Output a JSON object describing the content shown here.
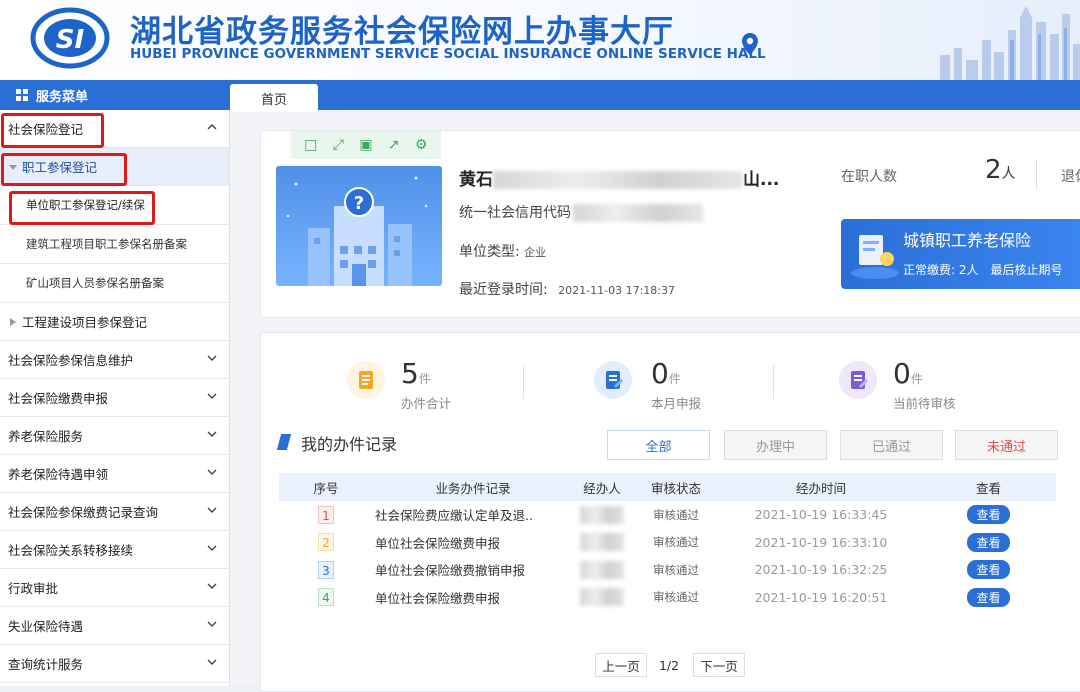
{
  "header": {
    "title_zh": "湖北省政务服务社会保险网上办事大厅",
    "title_en": "HUBEI PROVINCE GOVERNMENT SERVICE SOCIAL INSURANCE ONLINE SERVICE HALL",
    "logo_text": "SI"
  },
  "tabs": {
    "home": "首页"
  },
  "sidebar": {
    "header": "服务菜单",
    "items": [
      {
        "label": "社会保险登记",
        "icon": "chevron-up-icon"
      },
      {
        "label": "职工参保登记",
        "icon": "caret-down-icon"
      },
      {
        "label": "单位职工参保登记/续保"
      },
      {
        "label": "建筑工程项目职工参保名册备案"
      },
      {
        "label": "矿山项目人员参保名册备案"
      },
      {
        "label": "工程建设项目参保登记",
        "icon": "caret-right-icon"
      },
      {
        "label": "社会保险参保信息维护",
        "icon": "chevron-down-icon"
      },
      {
        "label": "社会保险缴费申报",
        "icon": "chevron-down-icon"
      },
      {
        "label": "养老保险服务",
        "icon": "chevron-down-icon"
      },
      {
        "label": "养老保险待遇申领",
        "icon": "chevron-down-icon"
      },
      {
        "label": "社会保险参保缴费记录查询",
        "icon": "chevron-down-icon"
      },
      {
        "label": "社会保险关系转移接续",
        "icon": "chevron-down-icon"
      },
      {
        "label": "行政审批",
        "icon": "chevron-down-icon"
      },
      {
        "label": "失业保险待遇",
        "icon": "chevron-down-icon"
      },
      {
        "label": "查询统计服务",
        "icon": "chevron-down-icon"
      }
    ]
  },
  "profile": {
    "company_name_start": "黄石",
    "company_name_end": "山...",
    "credit_code_label": "统一社会信用代码",
    "unit_type_label": "单位类型:",
    "unit_type_value": "企业",
    "last_login_label": "最近登录时间:",
    "last_login_value": "2021-11-03 17:18:37",
    "employees_label": "在职人数",
    "employees_value": "2",
    "employees_unit": "人",
    "retired_label": "退休"
  },
  "pension_card": {
    "title": "城镇职工养老保险",
    "normal_label": "正常缴费:",
    "normal_value": "2人",
    "last_check_label": "最后核止期号"
  },
  "stats": [
    {
      "value": "5",
      "unit": "件",
      "label": "办件合计",
      "color": "#f5a623"
    },
    {
      "value": "0",
      "unit": "件",
      "label": "本月申报",
      "color": "#2a6fd6"
    },
    {
      "value": "0",
      "unit": "件",
      "label": "当前待审核",
      "color": "#7b5bd6"
    }
  ],
  "records": {
    "title": "我的办件记录",
    "filters": [
      "全部",
      "办理中",
      "已通过",
      "未通过"
    ],
    "columns": [
      "序号",
      "业务办件记录",
      "经办人",
      "审核状态",
      "经办时间",
      "查看"
    ],
    "rows": [
      {
        "no": "1",
        "name": "社会保险费应缴认定单及退..",
        "status": "审核通过",
        "time": "2021-10-19 16:33:45",
        "action": "查看",
        "color": "#e24d4d"
      },
      {
        "no": "2",
        "name": "单位社会保险缴费申报",
        "status": "审核通过",
        "time": "2021-10-19 16:33:10",
        "action": "查看",
        "color": "#f5a623"
      },
      {
        "no": "3",
        "name": "单位社会保险缴费撤销申报",
        "status": "审核通过",
        "time": "2021-10-19 16:32:25",
        "action": "查看",
        "color": "#2a6fd6"
      },
      {
        "no": "4",
        "name": "单位社会保险缴费申报",
        "status": "审核通过",
        "time": "2021-10-19 16:20:51",
        "action": "查看",
        "color": "#3aa85a"
      }
    ],
    "pager": {
      "prev": "上一页",
      "page": "1/2",
      "next": "下一页"
    }
  }
}
